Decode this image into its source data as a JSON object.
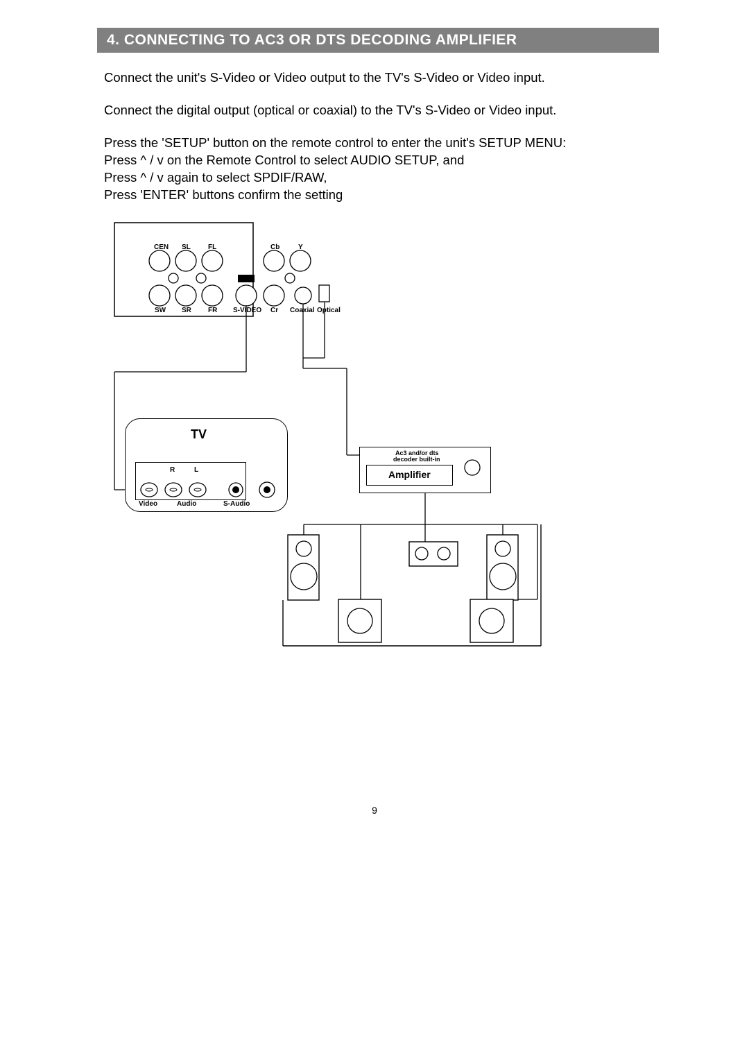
{
  "header": {
    "title": "4. CONNECTING TO AC3 OR DTS DECODING AMPLIFIER"
  },
  "paragraphs": {
    "p1": "Connect the unit's S-Video or Video output to the TV's S-Video or Video input.",
    "p2": "Connect the digital output (optical or coaxial) to the TV's S-Video or Video input.",
    "p3_l1": "Press the 'SETUP' button on the remote control to enter the unit's SETUP MENU:",
    "p3_l2": "Press ^ / v on the Remote Control to select AUDIO SETUP, and",
    "p3_l3": "Press ^ / v again to select SPDIF/RAW,",
    "p3_l4": "Press 'ENTER' buttons confirm the setting"
  },
  "diagram": {
    "rear_panel": {
      "CEN": "CEN",
      "SL": "SL",
      "FL": "FL",
      "SW": "SW",
      "SR": "SR",
      "FR": "FR",
      "VIDEO": "VIDEO",
      "SVIDEO": "S-VIDEO",
      "Cb": "Cb",
      "Y": "Y",
      "Cr": "Cr",
      "Coaxial": "Coaxial",
      "Optical": "Optical"
    },
    "tv": {
      "title": "TV",
      "R": "R",
      "L": "L",
      "Video": "Video",
      "Audio": "Audio",
      "SAudio": "S-Audio"
    },
    "amp": {
      "note_l1": "Ac3 and/or dts",
      "note_l2": "decoder built-in",
      "title": "Amplifier"
    }
  },
  "page_number": "9"
}
